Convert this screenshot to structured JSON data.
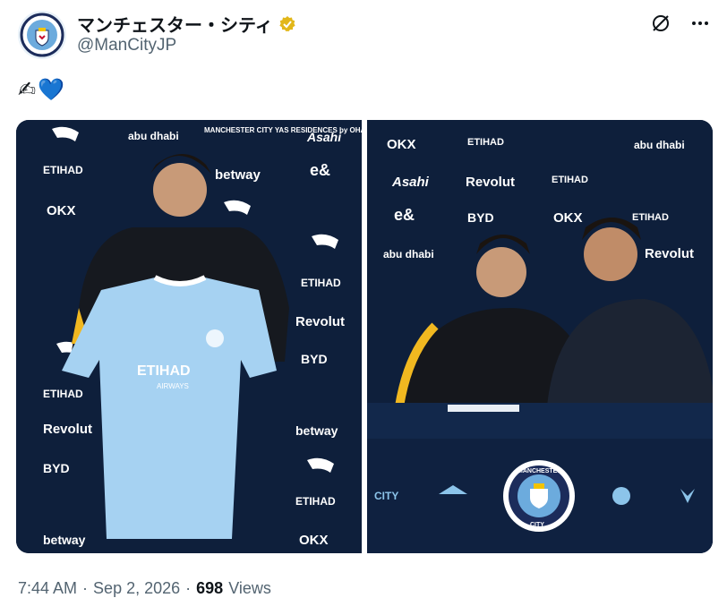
{
  "account": {
    "display_name": "マンチェスター・シティ",
    "handle": "@ManCityJP",
    "avatar_label": "MANCHESTER CITY",
    "verified_color": "#e2b719"
  },
  "tweet": {
    "text_emoji": [
      "✍",
      "💙"
    ]
  },
  "media": {
    "left_photo_sponsors": [
      "abu dhabi",
      "MANCHESTER CITY YAS RESIDENCES by OHANA",
      "Asahi",
      "ETIHAD",
      "betway",
      "e&",
      "OKX",
      "Revolut",
      "BYD"
    ],
    "right_photo_sponsors": [
      "OKX",
      "ETIHAD",
      "abu dhabi",
      "Asahi",
      "Revolut",
      "e&",
      "BYD"
    ],
    "shirt_sponsor": "ETIHAD",
    "shirt_sponsor_sub": "AIRWAYS",
    "crest_text_top": "MANCHESTER",
    "crest_text_bottom": "CITY",
    "table_left": "CITY"
  },
  "meta": {
    "time": "7:44 AM",
    "date": "Sep 2, 2026",
    "views_count": "698",
    "views_label": "Views"
  },
  "colors": {
    "backdrop": "#0e1f3b",
    "sky_blue": "#8cc4ea",
    "text_secondary": "#536471"
  }
}
